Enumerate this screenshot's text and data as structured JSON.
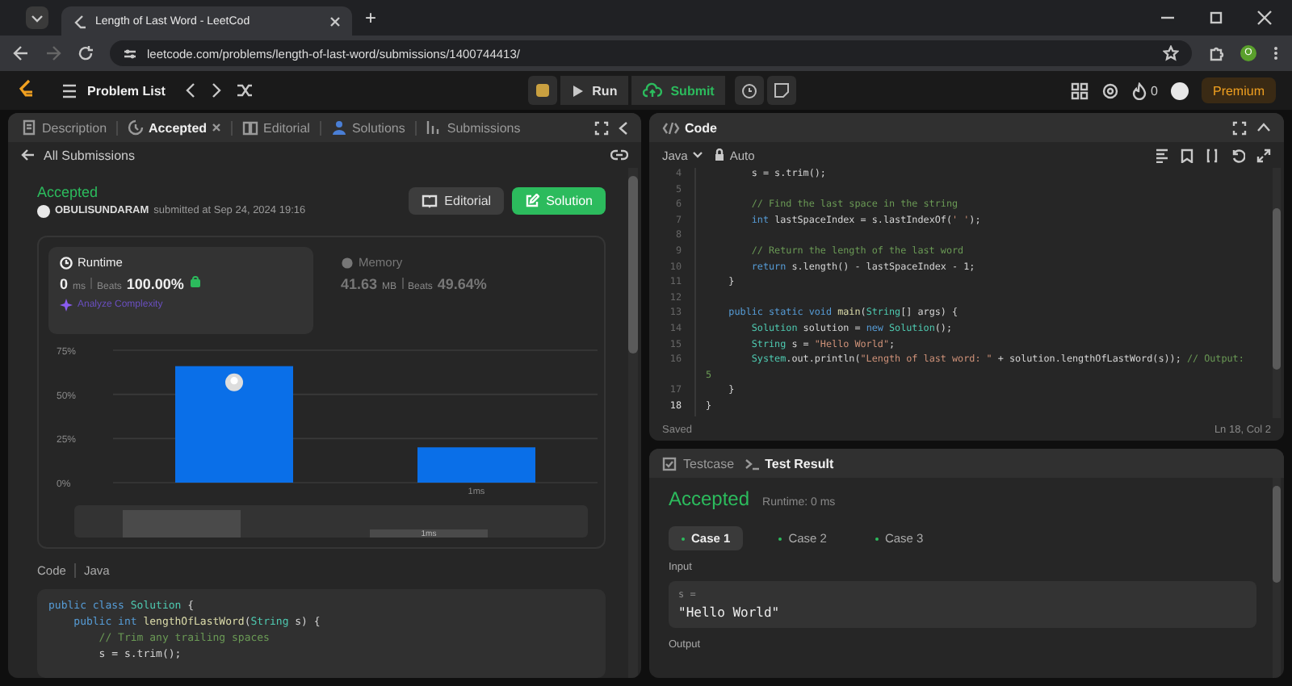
{
  "browser": {
    "tab_title": "Length of Last Word - LeetCod",
    "new_tab": "+",
    "url": "leetcode.com/problems/length-of-last-word/submissions/1400744413/",
    "profile_initial": "O"
  },
  "nav": {
    "problem_list": "Problem List",
    "run": "Run",
    "submit": "Submit",
    "streak": "0",
    "premium": "Premium"
  },
  "left_panel": {
    "tabs": [
      {
        "label": "Description",
        "selected": false,
        "closable": false
      },
      {
        "label": "Accepted",
        "selected": true,
        "closable": true
      },
      {
        "label": "Editorial",
        "selected": false,
        "closable": false
      },
      {
        "label": "Solutions",
        "selected": false,
        "closable": false
      },
      {
        "label": "Submissions",
        "selected": false,
        "closable": false
      }
    ],
    "back_link": "All Submissions",
    "status": "Accepted",
    "user": "OBULISUNDARAM",
    "submitted": "submitted at Sep 24, 2024 19:16",
    "buttons": [
      {
        "label": "Editorial",
        "kind": "secondary"
      },
      {
        "label": "Solution",
        "kind": "primary"
      }
    ],
    "stats": [
      {
        "title": "Runtime",
        "value": "0",
        "unit": "ms",
        "beats_label": "Beats",
        "beats": "100.00%",
        "selected": true
      },
      {
        "title": "Memory",
        "value": "41.63",
        "unit": "MB",
        "beats_label": "Beats",
        "beats": "49.64%",
        "selected": false
      }
    ],
    "analyze": "Analyze Complexity",
    "chart_data": {
      "type": "bar",
      "categories": [
        null,
        "1ms"
      ],
      "values": [
        66,
        20
      ],
      "ylim": [
        0,
        75
      ],
      "yticks": [
        {
          "value": 0,
          "label": "0%"
        },
        {
          "value": 25,
          "label": "25%"
        },
        {
          "value": 50,
          "label": "50%"
        },
        {
          "value": 75,
          "label": "75%"
        }
      ]
    },
    "navigator_label": "1ms",
    "code_label": "Code",
    "code_language": "Java",
    "code_lines": [
      [
        {
          "kind": "keyword",
          "text": "public class "
        },
        {
          "kind": "type",
          "text": "Solution"
        },
        {
          "kind": "plain",
          "text": " {"
        }
      ],
      [
        {
          "kind": "keyword",
          "text": "    public int "
        },
        {
          "kind": "function",
          "text": "lengthOfLastWord"
        },
        {
          "kind": "plain",
          "text": "("
        },
        {
          "kind": "type",
          "text": "String"
        },
        {
          "kind": "plain",
          "text": " s) {"
        }
      ],
      [
        {
          "kind": "comment",
          "text": "        // Trim any trailing spaces"
        }
      ],
      [
        {
          "kind": "plain",
          "text": "        s = s.trim();"
        }
      ]
    ]
  },
  "editor": {
    "title": "Code",
    "language": "Java",
    "mode": "Auto",
    "status": "Saved",
    "cursor": "Ln 18, Col 2",
    "lines": [
      {
        "n": "4",
        "current": false,
        "seg": [
          {
            "kind": "plain",
            "text": "        s = s.trim();"
          }
        ]
      },
      {
        "n": "5",
        "current": false
      },
      {
        "n": "6",
        "current": false,
        "seg": [
          {
            "kind": "comment",
            "text": "        // Find the last space in the string"
          }
        ]
      },
      {
        "n": "7",
        "current": false,
        "seg": [
          {
            "kind": "keyword",
            "text": "        int "
          },
          {
            "kind": "plain",
            "text": "lastSpaceIndex = s.lastIndexOf("
          },
          {
            "kind": "string",
            "text": "' '"
          },
          {
            "kind": "plain",
            "text": ");"
          }
        ]
      },
      {
        "n": "8",
        "current": false
      },
      {
        "n": "9",
        "current": false,
        "seg": [
          {
            "kind": "comment",
            "text": "        // Return the length of the last word"
          }
        ]
      },
      {
        "n": "10",
        "current": false,
        "seg": [
          {
            "kind": "keyword",
            "text": "        return "
          },
          {
            "kind": "plain",
            "text": "s.length() - lastSpaceIndex - 1;"
          }
        ]
      },
      {
        "n": "11",
        "current": false,
        "seg": [
          {
            "kind": "plain",
            "text": "    }"
          }
        ]
      },
      {
        "n": "12",
        "current": false
      },
      {
        "n": "13",
        "current": false,
        "seg": [
          {
            "kind": "keyword",
            "text": "    public static void "
          },
          {
            "kind": "function",
            "text": "main"
          },
          {
            "kind": "plain",
            "text": "("
          },
          {
            "kind": "type",
            "text": "String"
          },
          {
            "kind": "plain",
            "text": "[] args) {"
          }
        ]
      },
      {
        "n": "14",
        "current": false,
        "seg": [
          {
            "kind": "type",
            "text": "        Solution "
          },
          {
            "kind": "plain",
            "text": "solution = "
          },
          {
            "kind": "keyword",
            "text": "new "
          },
          {
            "kind": "type",
            "text": "Solution"
          },
          {
            "kind": "plain",
            "text": "();"
          }
        ]
      },
      {
        "n": "15",
        "current": false,
        "seg": [
          {
            "kind": "type",
            "text": "        String "
          },
          {
            "kind": "plain",
            "text": "s = "
          },
          {
            "kind": "string",
            "text": "\"Hello World\""
          },
          {
            "kind": "plain",
            "text": ";"
          }
        ]
      },
      {
        "n": "16",
        "current": false,
        "seg": [
          {
            "kind": "type",
            "text": "        System"
          },
          {
            "kind": "plain",
            "text": ".out.println("
          },
          {
            "kind": "string",
            "text": "\"Length of last word: \""
          },
          {
            "kind": "plain",
            "text": " + solution.lengthOfLastWord(s)); "
          },
          {
            "kind": "comment",
            "text": "// Output:"
          }
        ]
      },
      {
        "seg": [
          {
            "kind": "comment",
            "text": "5"
          }
        ]
      },
      {
        "n": "17",
        "current": false,
        "seg": [
          {
            "kind": "plain",
            "text": "    }"
          }
        ]
      },
      {
        "n": "18",
        "current": true,
        "seg": [
          {
            "kind": "plain",
            "text": "}"
          }
        ]
      }
    ]
  },
  "results": {
    "tabs": [
      {
        "label": "Testcase",
        "selected": false
      },
      {
        "label": "Test Result",
        "selected": true
      }
    ],
    "status": "Accepted",
    "runtime": "Runtime: 0 ms",
    "cases": [
      {
        "label": "Case 1",
        "selected": true
      },
      {
        "label": "Case 2",
        "selected": false
      },
      {
        "label": "Case 3",
        "selected": false
      }
    ],
    "input_label": "Input",
    "var_label": "s =",
    "var_value": "\"Hello World\"",
    "output_label": "Output"
  }
}
